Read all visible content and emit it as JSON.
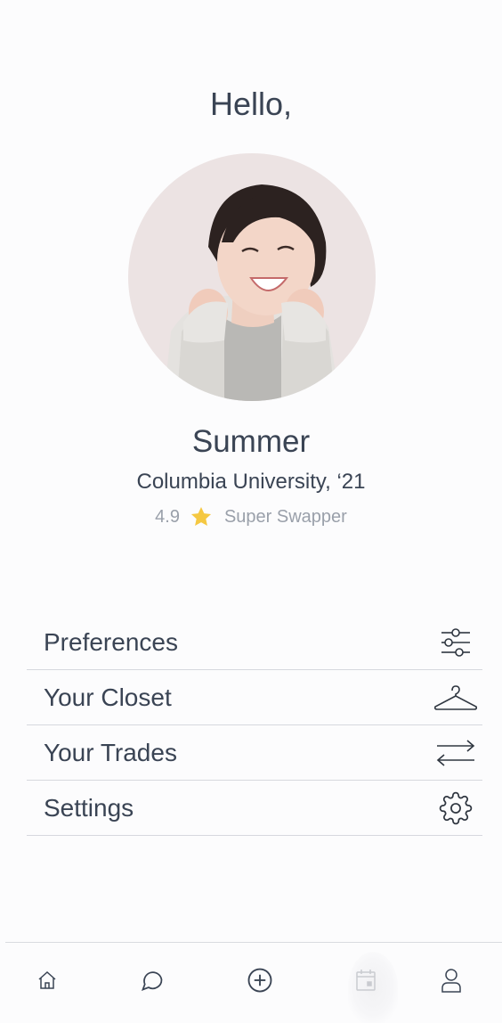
{
  "header": {
    "greeting": "Hello,"
  },
  "profile": {
    "name": "Summer",
    "school": "Columbia University, ‘21",
    "rating": "4.9",
    "rating_icon": "star-icon",
    "badge": "Super Swapper",
    "avatar": "profile-photo"
  },
  "menu": {
    "items": [
      {
        "label": "Preferences",
        "icon": "sliders-icon"
      },
      {
        "label": "Your Closet",
        "icon": "hanger-icon"
      },
      {
        "label": "Your Trades",
        "icon": "swap-arrows-icon"
      },
      {
        "label": "Settings",
        "icon": "gear-icon"
      }
    ]
  },
  "tabbar": {
    "tabs": [
      {
        "icon": "home-icon"
      },
      {
        "icon": "chat-icon"
      },
      {
        "icon": "add-circle-icon"
      },
      {
        "icon": "calendar-icon"
      },
      {
        "icon": "user-icon"
      }
    ]
  },
  "colors": {
    "text": "#3a4454",
    "muted": "#9aa0aa",
    "star": "#f5c842",
    "divider": "#d6d8de"
  }
}
